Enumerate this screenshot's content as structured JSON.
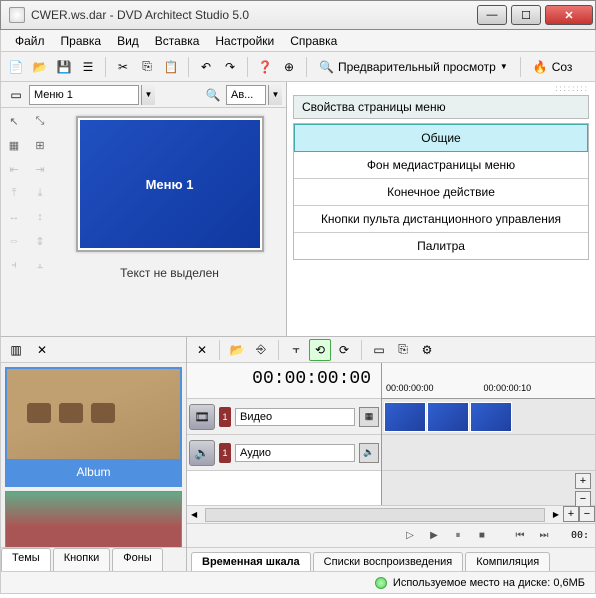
{
  "titlebar": {
    "text": "CWER.ws.dar - DVD Architect Studio 5.0"
  },
  "menubar": {
    "file": "Файл",
    "edit": "Правка",
    "view": "Вид",
    "insert": "Вставка",
    "settings": "Настройки",
    "help": "Справка"
  },
  "toolbar": {
    "preview_label": "Предварительный просмотр",
    "make_label": "Соз"
  },
  "editor": {
    "breadcrumb": "Меню 1",
    "zoom_label": "Ав...",
    "canvas_title": "Меню 1",
    "footer": "Текст не выделен"
  },
  "properties": {
    "header": "Свойства страницы меню",
    "items": [
      "Общие",
      "Фон медиастраницы меню",
      "Конечное действие",
      "Кнопки пульта дистанционного управления",
      "Палитра"
    ]
  },
  "gallery": {
    "album_label": "Album",
    "tabs": {
      "themes": "Темы",
      "buttons": "Кнопки",
      "backgrounds": "Фоны"
    }
  },
  "timeline": {
    "timecode": "00:00:00:00",
    "ruler_t1": "00:00:00:00",
    "ruler_t2": "00:00:00:10",
    "tracks": {
      "video": {
        "num": "1",
        "label": "Видео"
      },
      "audio": {
        "num": "1",
        "label": "Аудио"
      }
    },
    "tabs": {
      "timeline": "Временная шкала",
      "playlists": "Списки воспроизведения",
      "compilation": "Компиляция"
    },
    "end_timecode": "00:"
  },
  "status": {
    "disk_text": "Используемое место на диске: 0,6МБ"
  }
}
